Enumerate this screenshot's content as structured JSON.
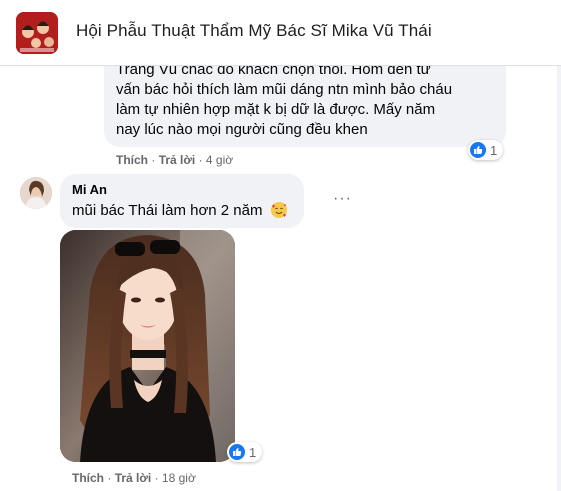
{
  "group": {
    "title": "Hội Phẫu Thuật Thẩm Mỹ Bác Sĩ Mika Vũ Thái",
    "avatar_icon": "group-photo-icon"
  },
  "comment1": {
    "lines": [
      "Trang Vũ chắc do khách chọn thôi. Hôm đến tư",
      "vấn bác hỏi thích làm mũi dáng ntn mình bảo cháu",
      "làm tự nhiên hợp mặt k bị dữ là được. Mấy năm",
      "nay lúc nào mọi người cũng đều khen"
    ],
    "reaction_count": "1",
    "like_label": "Thích",
    "reply_label": "Trả lời",
    "time": "4 giờ"
  },
  "comment2": {
    "author": "Mi An",
    "text": "mũi bác Thái làm hơn 2 năm",
    "emoji": "smiling-face-with-hearts-icon",
    "reaction_count": "1",
    "like_label": "Thích",
    "reply_label": "Trả lời",
    "time": "18 giờ"
  },
  "colors": {
    "bubble": "#f0f2f5",
    "meta_text": "#65676b",
    "like_blue": "#1877f2"
  }
}
